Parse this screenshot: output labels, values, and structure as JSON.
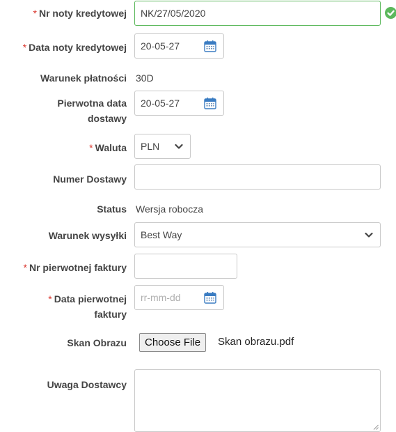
{
  "form": {
    "credit_note_number": {
      "label": "Nr noty kredytowej",
      "required_mark": "*",
      "value": "NK/27/05/2020"
    },
    "credit_note_date": {
      "label": "Data noty kredytowej",
      "required_mark": "*",
      "value": "20-05-27"
    },
    "payment_term": {
      "label": "Warunek płatności",
      "value": "30D"
    },
    "original_delivery_date": {
      "label": "Pierwotna data dostawy",
      "value": "20-05-27"
    },
    "currency": {
      "label": "Waluta",
      "required_mark": "*",
      "value": "PLN"
    },
    "delivery_number": {
      "label": "Numer Dostawy",
      "value": ""
    },
    "status": {
      "label": "Status",
      "value": "Wersja robocza"
    },
    "shipping_term": {
      "label": "Warunek wysyłki",
      "value": "Best Way"
    },
    "original_invoice_number": {
      "label": "Nr pierwotnej faktury",
      "required_mark": "*",
      "value": ""
    },
    "original_invoice_date": {
      "label": "Data pierwotnej faktury",
      "required_mark": "*",
      "placeholder": "rr-mm-dd"
    },
    "image_scan": {
      "label": "Skan Obrazu",
      "button_label": "Choose File",
      "file_name": "Skan obrazu.pdf"
    },
    "supplier_note": {
      "label": "Uwaga Dostawcy",
      "value": ""
    }
  },
  "icons": {
    "valid": "check-circle-icon",
    "calendar": "calendar-icon",
    "dropdown": "chevron-down-icon",
    "resize": "resize-handle-icon"
  },
  "colors": {
    "required": "#d9342b",
    "valid": "#5cb85c",
    "calendar": "#3a7cc2"
  }
}
